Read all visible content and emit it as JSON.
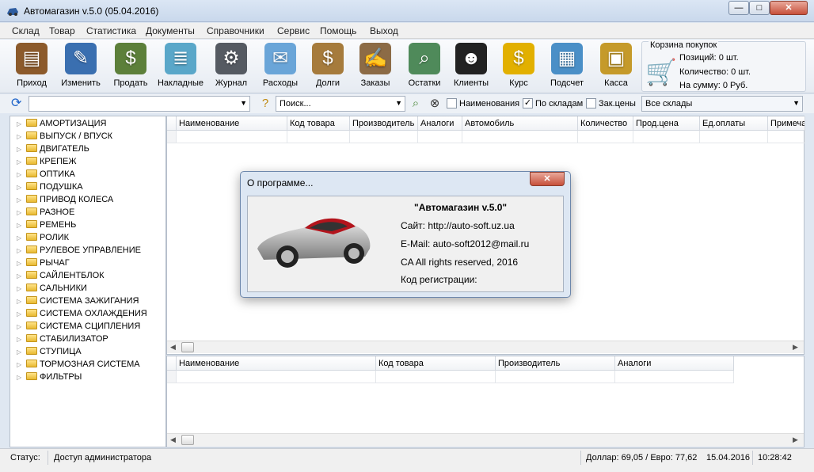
{
  "window": {
    "title": "Автомагазин v.5.0 (05.04.2016)",
    "min": "—",
    "max": "□",
    "close": "✕"
  },
  "menu": [
    "Склад",
    "Товар",
    "Статистика",
    "Документы",
    "Справочники",
    "Сервис",
    "Помощь",
    "Выход"
  ],
  "toolbar": [
    {
      "label": "Приход",
      "icon": "cash-register-icon",
      "glyph": "▤",
      "color": "#8c5a2b"
    },
    {
      "label": "Изменить",
      "icon": "pen-icon",
      "glyph": "✎",
      "color": "#3a6fb0"
    },
    {
      "label": "Продать",
      "icon": "money-stack-icon",
      "glyph": "$",
      "color": "#5c7f3a"
    },
    {
      "label": "Накладные",
      "icon": "documents-icon",
      "glyph": "≣",
      "color": "#5aa7c9"
    },
    {
      "label": "Журнал",
      "icon": "auto-parts-icon",
      "glyph": "⚙",
      "color": "#555a62"
    },
    {
      "label": "Расходы",
      "icon": "bills-icon",
      "glyph": "✉",
      "color": "#6aa5d8"
    },
    {
      "label": "Долги",
      "icon": "money-bag-icon",
      "glyph": "$",
      "color": "#a67b3c"
    },
    {
      "label": "Заказы",
      "icon": "order-notebook-icon",
      "glyph": "✍",
      "color": "#8c6b46"
    },
    {
      "label": "Остатки",
      "icon": "magnifier-icon",
      "glyph": "⌕",
      "color": "#4f8a5a"
    },
    {
      "label": "Клиенты",
      "icon": "people-icon",
      "glyph": "☻",
      "color": "#222222"
    },
    {
      "label": "Курс",
      "icon": "dollar-sign-icon",
      "glyph": "$",
      "color": "#e2b000"
    },
    {
      "label": "Подсчет",
      "icon": "calculator-icon",
      "glyph": "▦",
      "color": "#4a8fc7"
    },
    {
      "label": "Касса",
      "icon": "safe-icon",
      "glyph": "▣",
      "color": "#c59a2a"
    }
  ],
  "cart": {
    "title": "Корзина покупок",
    "positions": "Позиций: 0 шт.",
    "quantity": "Количество: 0 шт.",
    "sum": "На сумму: 0 Руб."
  },
  "search": {
    "combo_value": "",
    "search_value": "Поиск...",
    "chk_names": {
      "label": "Наименования",
      "checked": false
    },
    "chk_stores": {
      "label": "По складам",
      "checked": true
    },
    "chk_prices": {
      "label": "Зак.цены",
      "checked": false
    },
    "store_select": "Все склады"
  },
  "tree": [
    "АМОРТИЗАЦИЯ",
    "ВЫПУСК / ВПУСК",
    "ДВИГАТЕЛЬ",
    "КРЕПЕЖ",
    "ОПТИКА",
    "ПОДУШКА",
    "ПРИВОД КОЛЕСА",
    "РАЗНОЕ",
    "РЕМЕНЬ",
    "РОЛИК",
    "РУЛЕВОЕ УПРАВЛЕНИЕ",
    "РЫЧАГ",
    "САЙЛЕНТБЛОК",
    "САЛЬНИКИ",
    "СИСТЕМА ЗАЖИГАНИЯ",
    "СИСТЕМА ОХЛАЖДЕНИЯ",
    "СИСТЕМА СЦИПЛЕНИЯ",
    "СТАБИЛИЗАТОР",
    "СТУПИЦА",
    "ТОРМОЗНАЯ СИСТЕМА",
    "ФИЛЬТРЫ"
  ],
  "grid_top": {
    "columns": [
      "Наименование",
      "Код товара",
      "Производитель",
      "Аналоги",
      "Автомобиль",
      "Количество",
      "Прод.цена",
      "Ед.оплаты",
      "Примеча"
    ]
  },
  "grid_bottom": {
    "columns": [
      "Наименование",
      "Код товара",
      "Производитель",
      "Аналоги"
    ]
  },
  "status": {
    "label": "Статус:",
    "value": "Доступ администратора",
    "rates": "Доллар: 69,05 / Евро: 77,62",
    "date": "15.04.2016",
    "time": "10:28:42"
  },
  "about": {
    "title": "О программе...",
    "close": "✕",
    "name": "\"Автомагазин v.5.0\"",
    "site": "Сайт: http://auto-soft.uz.ua",
    "email": "E-Mail: auto-soft2012@mail.ru",
    "rights": "CA All rights reserved, 2016",
    "reg": "Код регистрации:"
  }
}
